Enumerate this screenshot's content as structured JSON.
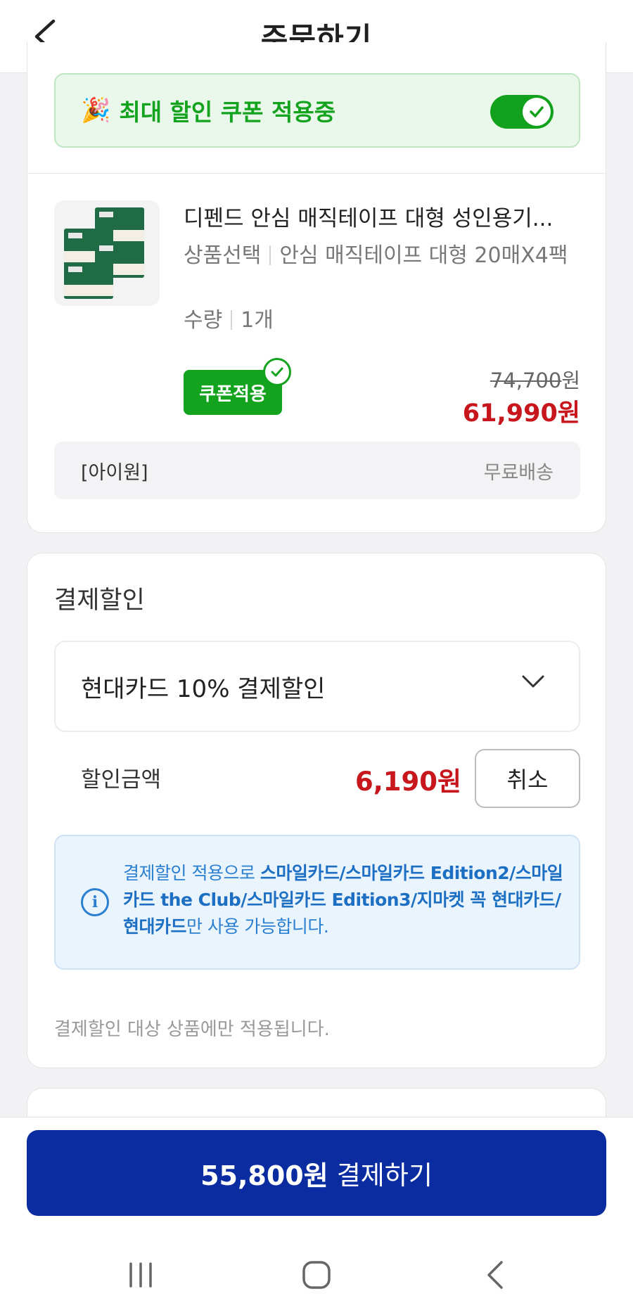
{
  "header": {
    "title": "주문하기"
  },
  "coupon_banner": {
    "emoji": "🎉",
    "label": "최대 할인 쿠폰 적용중",
    "toggle_on": true
  },
  "product": {
    "name": "디펜드 안심 매직테이프 대형 성인용기...",
    "option_label": "상품선택",
    "option_value": "안심 매직테이프 대형 20매X4팩",
    "qty_label": "수량",
    "qty_value": "1개",
    "coupon_badge": "쿠폰적용",
    "original_price": "74,700",
    "sale_price": "61,990원",
    "currency": "원",
    "seller": "[아이원]",
    "shipping": "무료배송"
  },
  "payment_discount": {
    "title": "결제할인",
    "selected": "현대카드 10% 결제할인",
    "amount_label": "할인금액",
    "amount": "6,190원",
    "cancel_label": "취소",
    "notice_prefix": "결제할인 적용으로 ",
    "notice_cards": "스마일카드/스마일카드 Edition2/스마일카드 the Club/스마일카드 Edition3/지마켓 꼭 현대카드/현대카드",
    "notice_suffix": "만 사용 가능합니다.",
    "footnote": "결제할인 대상 상품에만 적용됩니다."
  },
  "checkout": {
    "amount": "55,800원",
    "label": "결제하기"
  },
  "colors": {
    "accent_green": "#13a31f",
    "price_red": "#c8161d",
    "pay_blue": "#0a2ca0",
    "info_blue": "#2a7fd1"
  },
  "icons": [
    "back-arrow-icon",
    "check-icon",
    "chevron-down-icon",
    "info-icon",
    "recent-apps-icon",
    "home-icon",
    "nav-back-icon"
  ]
}
